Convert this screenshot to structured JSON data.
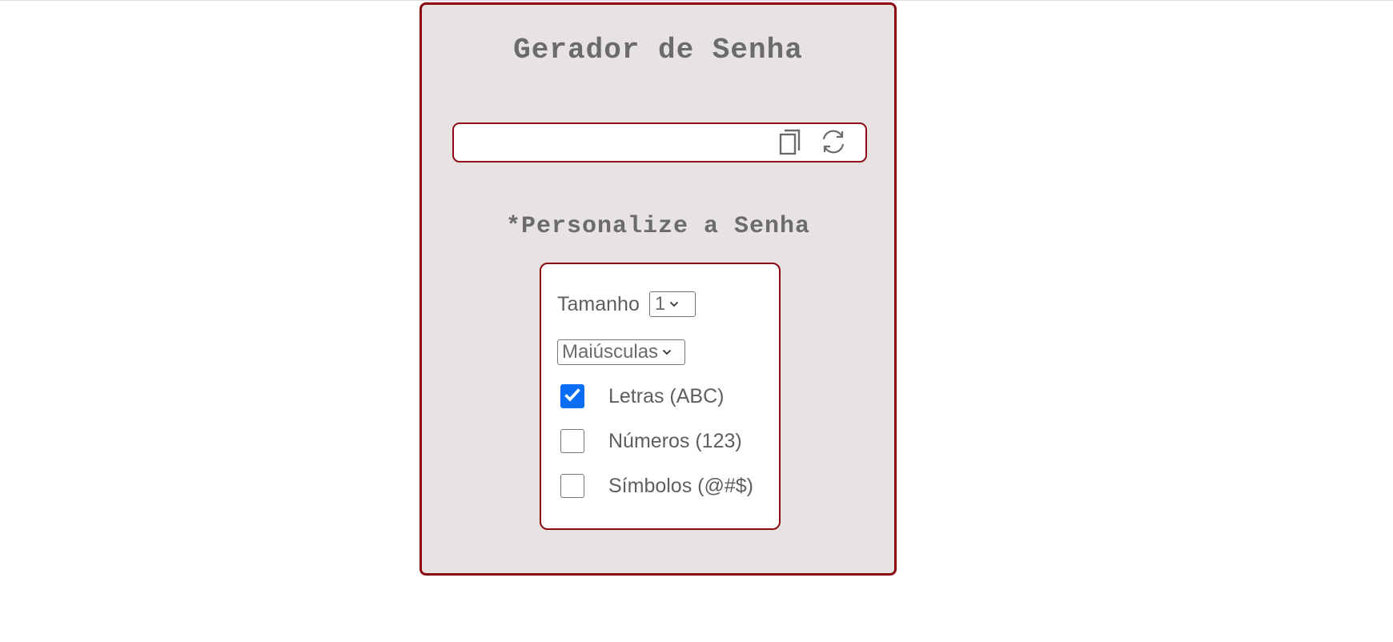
{
  "app": {
    "title": "Gerador de Senha",
    "subtitle": "*Personalize a Senha"
  },
  "password": {
    "value": "",
    "copy_icon": "copy-icon",
    "refresh_icon": "refresh-icon"
  },
  "options": {
    "size_label": "Tamanho",
    "size_selected": "1",
    "case_selected": "Maiúsculas",
    "checkboxes": [
      {
        "label": "Letras (ABC)",
        "checked": true
      },
      {
        "label": "Números (123)",
        "checked": false
      },
      {
        "label": "Símbolos (@#$)",
        "checked": false
      }
    ]
  },
  "colors": {
    "accent_border": "#8b0a14",
    "card_background": "#e6e3e2",
    "text": "#6b6b6b",
    "checkbox_checked": "#0a6ef5"
  }
}
